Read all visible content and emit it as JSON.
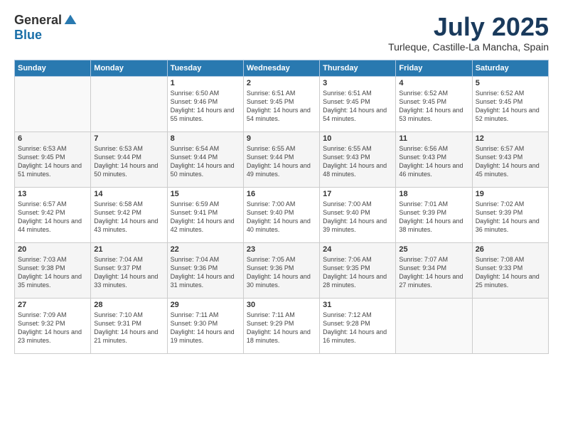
{
  "logo": {
    "general": "General",
    "blue": "Blue"
  },
  "title": {
    "month": "July 2025",
    "location": "Turleque, Castille-La Mancha, Spain"
  },
  "headers": [
    "Sunday",
    "Monday",
    "Tuesday",
    "Wednesday",
    "Thursday",
    "Friday",
    "Saturday"
  ],
  "weeks": [
    [
      {
        "day": "",
        "sunrise": "",
        "sunset": "",
        "daylight": ""
      },
      {
        "day": "",
        "sunrise": "",
        "sunset": "",
        "daylight": ""
      },
      {
        "day": "1",
        "sunrise": "Sunrise: 6:50 AM",
        "sunset": "Sunset: 9:46 PM",
        "daylight": "Daylight: 14 hours and 55 minutes."
      },
      {
        "day": "2",
        "sunrise": "Sunrise: 6:51 AM",
        "sunset": "Sunset: 9:45 PM",
        "daylight": "Daylight: 14 hours and 54 minutes."
      },
      {
        "day": "3",
        "sunrise": "Sunrise: 6:51 AM",
        "sunset": "Sunset: 9:45 PM",
        "daylight": "Daylight: 14 hours and 54 minutes."
      },
      {
        "day": "4",
        "sunrise": "Sunrise: 6:52 AM",
        "sunset": "Sunset: 9:45 PM",
        "daylight": "Daylight: 14 hours and 53 minutes."
      },
      {
        "day": "5",
        "sunrise": "Sunrise: 6:52 AM",
        "sunset": "Sunset: 9:45 PM",
        "daylight": "Daylight: 14 hours and 52 minutes."
      }
    ],
    [
      {
        "day": "6",
        "sunrise": "Sunrise: 6:53 AM",
        "sunset": "Sunset: 9:45 PM",
        "daylight": "Daylight: 14 hours and 51 minutes."
      },
      {
        "day": "7",
        "sunrise": "Sunrise: 6:53 AM",
        "sunset": "Sunset: 9:44 PM",
        "daylight": "Daylight: 14 hours and 50 minutes."
      },
      {
        "day": "8",
        "sunrise": "Sunrise: 6:54 AM",
        "sunset": "Sunset: 9:44 PM",
        "daylight": "Daylight: 14 hours and 50 minutes."
      },
      {
        "day": "9",
        "sunrise": "Sunrise: 6:55 AM",
        "sunset": "Sunset: 9:44 PM",
        "daylight": "Daylight: 14 hours and 49 minutes."
      },
      {
        "day": "10",
        "sunrise": "Sunrise: 6:55 AM",
        "sunset": "Sunset: 9:43 PM",
        "daylight": "Daylight: 14 hours and 48 minutes."
      },
      {
        "day": "11",
        "sunrise": "Sunrise: 6:56 AM",
        "sunset": "Sunset: 9:43 PM",
        "daylight": "Daylight: 14 hours and 46 minutes."
      },
      {
        "day": "12",
        "sunrise": "Sunrise: 6:57 AM",
        "sunset": "Sunset: 9:43 PM",
        "daylight": "Daylight: 14 hours and 45 minutes."
      }
    ],
    [
      {
        "day": "13",
        "sunrise": "Sunrise: 6:57 AM",
        "sunset": "Sunset: 9:42 PM",
        "daylight": "Daylight: 14 hours and 44 minutes."
      },
      {
        "day": "14",
        "sunrise": "Sunrise: 6:58 AM",
        "sunset": "Sunset: 9:42 PM",
        "daylight": "Daylight: 14 hours and 43 minutes."
      },
      {
        "day": "15",
        "sunrise": "Sunrise: 6:59 AM",
        "sunset": "Sunset: 9:41 PM",
        "daylight": "Daylight: 14 hours and 42 minutes."
      },
      {
        "day": "16",
        "sunrise": "Sunrise: 7:00 AM",
        "sunset": "Sunset: 9:40 PM",
        "daylight": "Daylight: 14 hours and 40 minutes."
      },
      {
        "day": "17",
        "sunrise": "Sunrise: 7:00 AM",
        "sunset": "Sunset: 9:40 PM",
        "daylight": "Daylight: 14 hours and 39 minutes."
      },
      {
        "day": "18",
        "sunrise": "Sunrise: 7:01 AM",
        "sunset": "Sunset: 9:39 PM",
        "daylight": "Daylight: 14 hours and 38 minutes."
      },
      {
        "day": "19",
        "sunrise": "Sunrise: 7:02 AM",
        "sunset": "Sunset: 9:39 PM",
        "daylight": "Daylight: 14 hours and 36 minutes."
      }
    ],
    [
      {
        "day": "20",
        "sunrise": "Sunrise: 7:03 AM",
        "sunset": "Sunset: 9:38 PM",
        "daylight": "Daylight: 14 hours and 35 minutes."
      },
      {
        "day": "21",
        "sunrise": "Sunrise: 7:04 AM",
        "sunset": "Sunset: 9:37 PM",
        "daylight": "Daylight: 14 hours and 33 minutes."
      },
      {
        "day": "22",
        "sunrise": "Sunrise: 7:04 AM",
        "sunset": "Sunset: 9:36 PM",
        "daylight": "Daylight: 14 hours and 31 minutes."
      },
      {
        "day": "23",
        "sunrise": "Sunrise: 7:05 AM",
        "sunset": "Sunset: 9:36 PM",
        "daylight": "Daylight: 14 hours and 30 minutes."
      },
      {
        "day": "24",
        "sunrise": "Sunrise: 7:06 AM",
        "sunset": "Sunset: 9:35 PM",
        "daylight": "Daylight: 14 hours and 28 minutes."
      },
      {
        "day": "25",
        "sunrise": "Sunrise: 7:07 AM",
        "sunset": "Sunset: 9:34 PM",
        "daylight": "Daylight: 14 hours and 27 minutes."
      },
      {
        "day": "26",
        "sunrise": "Sunrise: 7:08 AM",
        "sunset": "Sunset: 9:33 PM",
        "daylight": "Daylight: 14 hours and 25 minutes."
      }
    ],
    [
      {
        "day": "27",
        "sunrise": "Sunrise: 7:09 AM",
        "sunset": "Sunset: 9:32 PM",
        "daylight": "Daylight: 14 hours and 23 minutes."
      },
      {
        "day": "28",
        "sunrise": "Sunrise: 7:10 AM",
        "sunset": "Sunset: 9:31 PM",
        "daylight": "Daylight: 14 hours and 21 minutes."
      },
      {
        "day": "29",
        "sunrise": "Sunrise: 7:11 AM",
        "sunset": "Sunset: 9:30 PM",
        "daylight": "Daylight: 14 hours and 19 minutes."
      },
      {
        "day": "30",
        "sunrise": "Sunrise: 7:11 AM",
        "sunset": "Sunset: 9:29 PM",
        "daylight": "Daylight: 14 hours and 18 minutes."
      },
      {
        "day": "31",
        "sunrise": "Sunrise: 7:12 AM",
        "sunset": "Sunset: 9:28 PM",
        "daylight": "Daylight: 14 hours and 16 minutes."
      },
      {
        "day": "",
        "sunrise": "",
        "sunset": "",
        "daylight": ""
      },
      {
        "day": "",
        "sunrise": "",
        "sunset": "",
        "daylight": ""
      }
    ]
  ]
}
